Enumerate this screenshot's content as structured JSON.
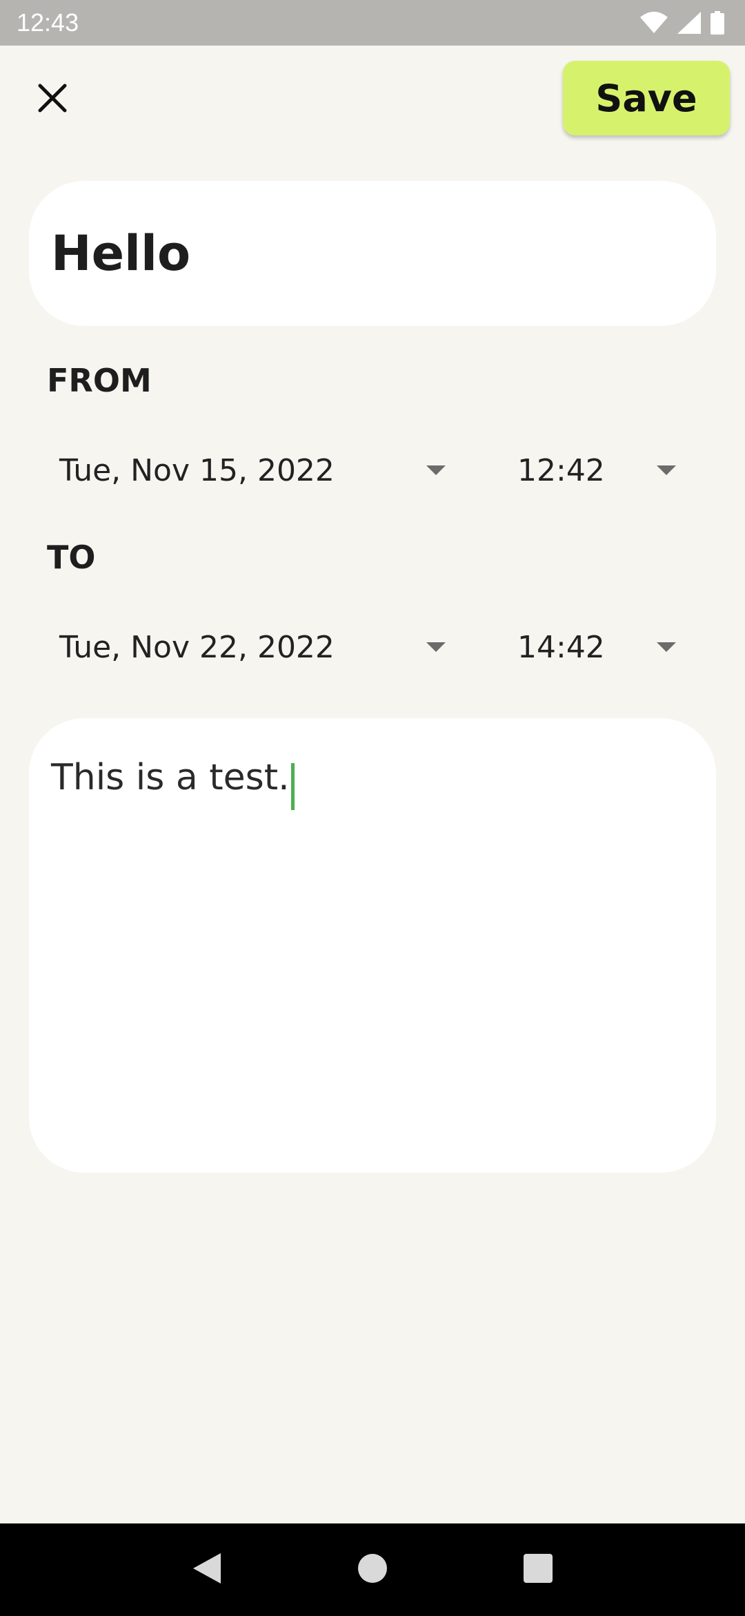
{
  "status_bar": {
    "time": "12:43",
    "icons": [
      "wifi-icon",
      "cellular-signal-icon",
      "battery-icon"
    ]
  },
  "toolbar": {
    "close_icon": "close-icon",
    "save_label": "Save",
    "save_color": "#d6f26c"
  },
  "event": {
    "title": "Hello",
    "from": {
      "label": "FROM",
      "date": "Tue, Nov 15, 2022",
      "time": "12:42"
    },
    "to": {
      "label": "TO",
      "date": "Tue, Nov 22, 2022",
      "time": "14:42"
    },
    "notes": "This is a test."
  },
  "colors": {
    "background": "#f6f5f0",
    "card": "#ffffff",
    "accent": "#d6f26c",
    "cursor": "#4caf50"
  },
  "nav_bar": {
    "buttons": [
      "back-icon",
      "home-icon",
      "recents-icon"
    ]
  }
}
